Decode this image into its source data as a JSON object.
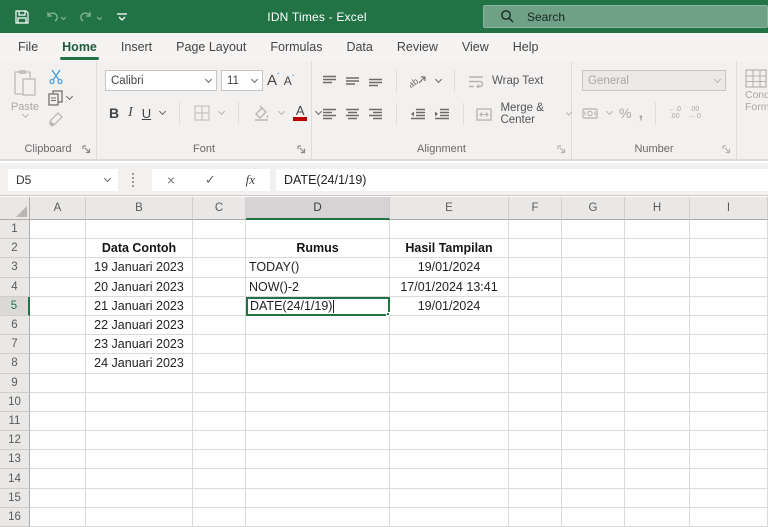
{
  "titlebar": {
    "title": "IDN Times  -  Excel",
    "search_placeholder": "Search"
  },
  "tabs": [
    {
      "label": "File",
      "active": false
    },
    {
      "label": "Home",
      "active": true
    },
    {
      "label": "Insert",
      "active": false
    },
    {
      "label": "Page Layout",
      "active": false
    },
    {
      "label": "Formulas",
      "active": false
    },
    {
      "label": "Data",
      "active": false
    },
    {
      "label": "Review",
      "active": false
    },
    {
      "label": "View",
      "active": false
    },
    {
      "label": "Help",
      "active": false
    }
  ],
  "ribbon": {
    "groups": {
      "clipboard": {
        "label": "Clipboard",
        "paste": "Paste"
      },
      "font": {
        "label": "Font",
        "font_name": "Calibri",
        "font_size": "11"
      },
      "alignment": {
        "label": "Alignment",
        "wrap_text": "Wrap Text",
        "merge_center": "Merge & Center"
      },
      "number": {
        "label": "Number",
        "format": "General"
      },
      "styles": {
        "line1": "Cond",
        "line2": "Forma"
      }
    }
  },
  "formula_bar": {
    "name_box": "D5",
    "formula": "DATE(24/1/19)"
  },
  "grid": {
    "columns": [
      "A",
      "B",
      "C",
      "D",
      "E",
      "F",
      "G",
      "H",
      "I"
    ],
    "rows": [
      "1",
      "2",
      "3",
      "4",
      "5",
      "6",
      "7",
      "8",
      "9",
      "10",
      "11",
      "12",
      "13",
      "14",
      "15",
      "16"
    ],
    "selection": {
      "active_cell": "D5",
      "selected_column": "D",
      "selected_row": "5"
    },
    "cells": [
      {
        "ref": "B2",
        "text": "Data Contoh",
        "bold": true,
        "align": "center"
      },
      {
        "ref": "D2",
        "text": "Rumus",
        "bold": true,
        "align": "center"
      },
      {
        "ref": "E2",
        "text": "Hasil Tampilan",
        "bold": true,
        "align": "center"
      },
      {
        "ref": "B3",
        "text": "19 Januari 2023",
        "align": "center"
      },
      {
        "ref": "B4",
        "text": "20 Januari 2023",
        "align": "center"
      },
      {
        "ref": "B5",
        "text": "21 Januari 2023",
        "align": "center"
      },
      {
        "ref": "B6",
        "text": "22 Januari 2023",
        "align": "center"
      },
      {
        "ref": "B7",
        "text": "23 Januari 2023",
        "align": "center"
      },
      {
        "ref": "B8",
        "text": "24 Januari 2023",
        "align": "center"
      },
      {
        "ref": "D3",
        "text": "TODAY()",
        "align": "left"
      },
      {
        "ref": "D4",
        "text": "NOW()-2",
        "align": "left"
      },
      {
        "ref": "D5",
        "text": "DATE(24/1/19)",
        "align": "left",
        "editing": true
      },
      {
        "ref": "E3",
        "text": "19/01/2024",
        "align": "center"
      },
      {
        "ref": "E4",
        "text": "17/01/2024 13:41",
        "align": "center"
      },
      {
        "ref": "E5",
        "text": "19/01/2024",
        "align": "center"
      }
    ]
  },
  "colors": {
    "titlebar_green": "#217346",
    "accent_green": "#217346",
    "search_box_green": "#6fa187",
    "font_color_red": "#c00000"
  }
}
